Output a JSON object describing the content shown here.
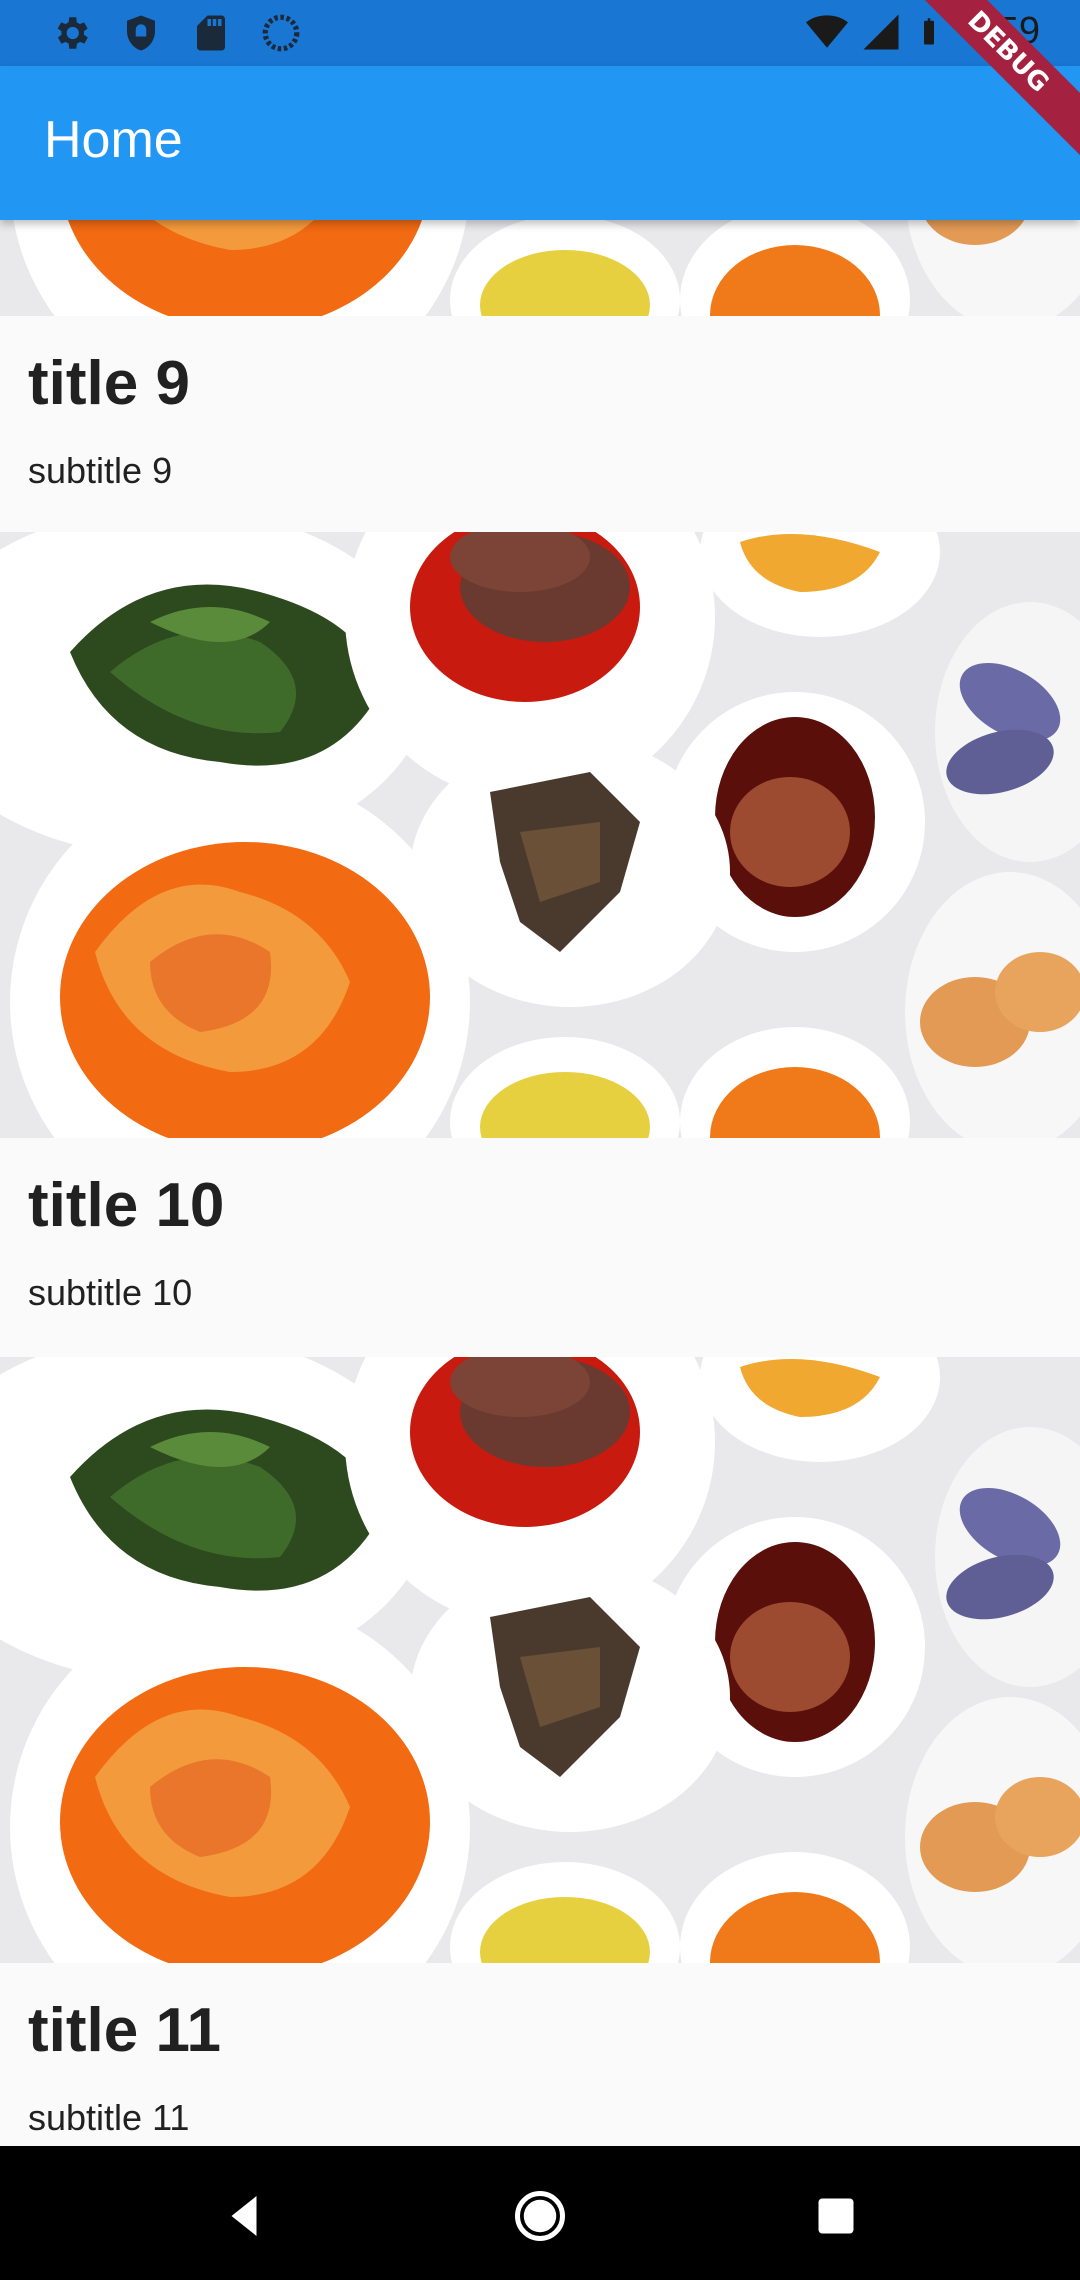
{
  "status_bar": {
    "time": "6:59",
    "left_icons": [
      "gear-icon",
      "shield-icon",
      "sd-card-icon",
      "sync-icon"
    ],
    "right_icons": [
      "wifi-icon",
      "cell-signal-icon",
      "battery-icon"
    ]
  },
  "debug_banner": {
    "label": "DEBUG",
    "color": "#a4223f"
  },
  "app_bar": {
    "title": "Home",
    "color": "#2196f3"
  },
  "list": {
    "items": [
      {
        "title": "title 9",
        "subtitle": "subtitle 9"
      },
      {
        "title": "title 10",
        "subtitle": "subtitle 10"
      },
      {
        "title": "title 11",
        "subtitle": "subtitle 11"
      }
    ]
  },
  "nav_bar": {
    "buttons": [
      "back-icon",
      "home-icon",
      "recents-icon"
    ]
  }
}
